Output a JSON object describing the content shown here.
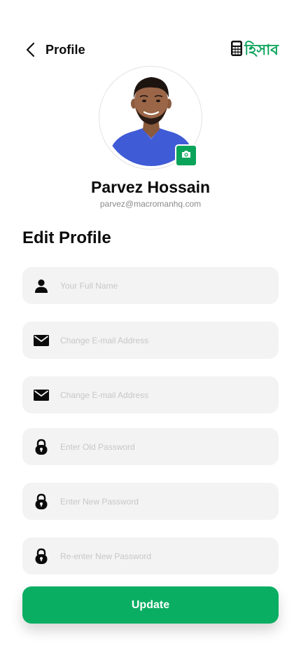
{
  "header": {
    "title": "Profile",
    "back_icon": "chevron-left-icon",
    "logo_icon": "calculator-icon",
    "logo_text": "হিসাব"
  },
  "profile": {
    "name": "Parvez Hossain",
    "email": "parvez@macromanhq.com",
    "camera_icon": "camera-icon"
  },
  "form": {
    "title": "Edit Profile",
    "fields": [
      {
        "placeholder": "Your Full Name",
        "value": "",
        "icon": "user-icon"
      },
      {
        "placeholder": "Change E-mail Address",
        "value": "",
        "icon": "mail-icon"
      },
      {
        "placeholder": "Change E-mail Address",
        "value": "",
        "icon": "mail-icon"
      },
      {
        "placeholder": "Enter Old Password",
        "value": "",
        "icon": "lock-icon"
      },
      {
        "placeholder": "Enter New Password",
        "value": "",
        "icon": "lock-icon"
      },
      {
        "placeholder": "Re-enter New Password",
        "value": "",
        "icon": "lock-icon"
      }
    ],
    "submit_label": "Update"
  },
  "colors": {
    "accent": "#0AAE63",
    "field_bg": "#F3F3F3",
    "placeholder": "#C7C7C7",
    "text": "#0B0B0B",
    "muted": "#8A8A8A"
  }
}
